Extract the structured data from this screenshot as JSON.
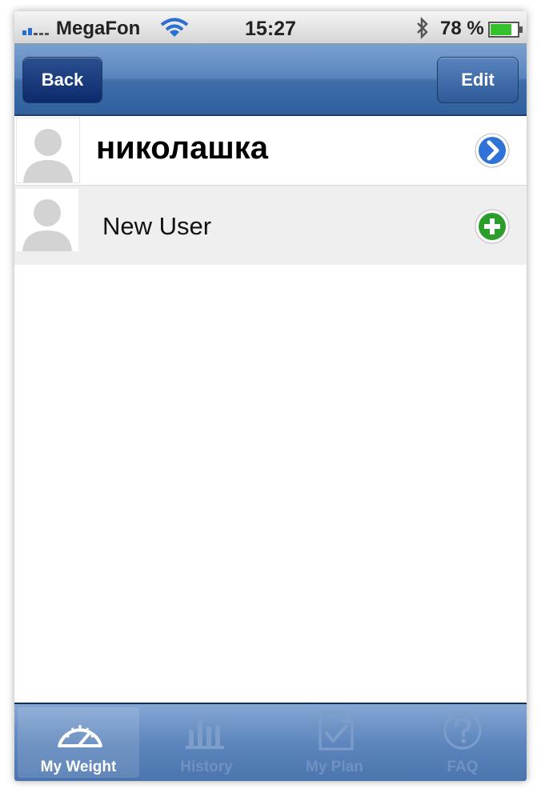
{
  "status_bar": {
    "carrier": "MegaFon",
    "time": "15:27",
    "battery": "78 %",
    "battery_level_fraction": 0.78,
    "icons": [
      "signal-icon",
      "wifi-icon",
      "bluetooth-icon",
      "battery-icon"
    ]
  },
  "nav": {
    "back_label": "Back",
    "edit_label": "Edit"
  },
  "users": [
    {
      "name": "николашка",
      "action_icon": "chevron-right-icon"
    }
  ],
  "new_user": {
    "label": "New User",
    "action_icon": "add-icon"
  },
  "tabs": [
    {
      "label": "My Weight",
      "icon": "gauge-icon",
      "active": true
    },
    {
      "label": "History",
      "icon": "bar-chart-icon",
      "active": false
    },
    {
      "label": "My Plan",
      "icon": "checklist-icon",
      "active": false
    },
    {
      "label": "FAQ",
      "icon": "question-icon",
      "active": false
    }
  ],
  "colors": {
    "accent_blue": "#2a6fd0",
    "nav_blue": "#3f6eaa",
    "add_green": "#2a9d2a",
    "battery_green": "#35c12d"
  }
}
